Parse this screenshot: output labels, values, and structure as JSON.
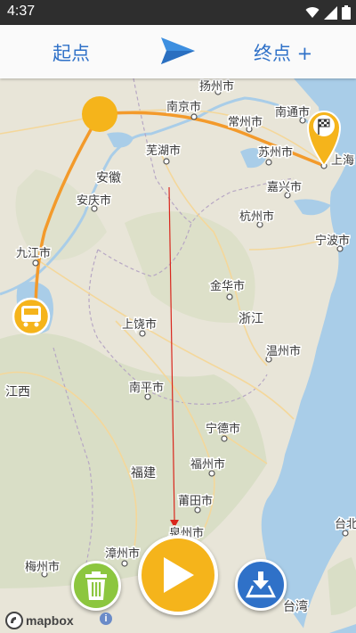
{
  "status_bar": {
    "time": "4:37"
  },
  "toolbar": {
    "start_label": "起点",
    "end_label": "终点 +"
  },
  "map": {
    "labels": [
      {
        "id": "yangzhou",
        "text": "扬州市"
      },
      {
        "id": "nanjing",
        "text": "南京市"
      },
      {
        "id": "changzhou",
        "text": "常州市"
      },
      {
        "id": "nantong",
        "text": "南通市"
      },
      {
        "id": "wuhu",
        "text": "芜湖市"
      },
      {
        "id": "suzhou",
        "text": "苏州市"
      },
      {
        "id": "shanghai",
        "text": "上海"
      },
      {
        "id": "anhui",
        "text": "安徽"
      },
      {
        "id": "jiaxing",
        "text": "嘉兴市"
      },
      {
        "id": "anqing",
        "text": "安庆市"
      },
      {
        "id": "hangzhou",
        "text": "杭州市"
      },
      {
        "id": "ningbo",
        "text": "宁波市"
      },
      {
        "id": "jiujiang",
        "text": "九江市"
      },
      {
        "id": "jinhua",
        "text": "金华市"
      },
      {
        "id": "zhejiang",
        "text": "浙江"
      },
      {
        "id": "shangrao",
        "text": "上饶市"
      },
      {
        "id": "wenzhou",
        "text": "温州市"
      },
      {
        "id": "jiangxi",
        "text": "江西"
      },
      {
        "id": "nanping",
        "text": "南平市"
      },
      {
        "id": "ningde",
        "text": "宁德市"
      },
      {
        "id": "fuzhou",
        "text": "福州市"
      },
      {
        "id": "fujian",
        "text": "福建"
      },
      {
        "id": "putian",
        "text": "莆田市"
      },
      {
        "id": "quanzhou",
        "text": "泉州市"
      },
      {
        "id": "taibei",
        "text": "台北"
      },
      {
        "id": "zhangzhou",
        "text": "漳州市"
      },
      {
        "id": "meizhou",
        "text": "梅州市"
      },
      {
        "id": "taiwan",
        "text": "台湾"
      }
    ],
    "route_color": "#f39a2b",
    "direction_line_color": "#d9261c",
    "water_color": "#a9cde8"
  },
  "attribution": {
    "logo_text": "mapbox",
    "info_symbol": "i"
  },
  "colors": {
    "accent_blue": "#2f71c8",
    "play_yellow": "#f5b41b",
    "trash_green": "#8cc63f"
  }
}
